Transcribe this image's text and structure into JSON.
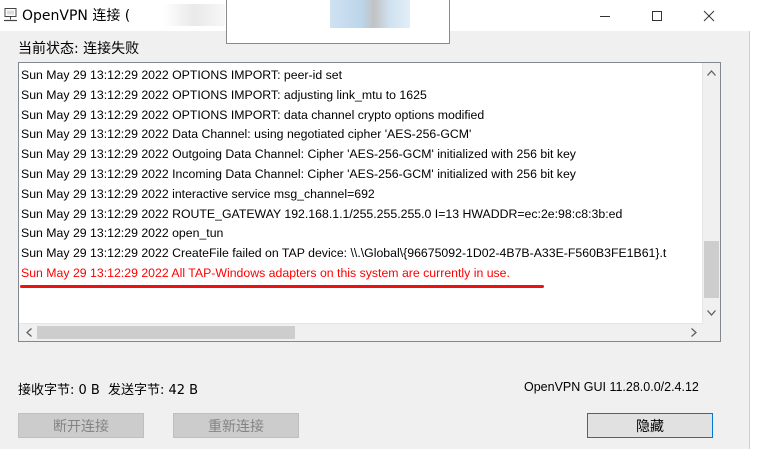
{
  "window": {
    "title": "OpenVPN 连接 (",
    "controls": {
      "minimize": "—",
      "maximize": "☐",
      "close": "✕"
    }
  },
  "status": {
    "label": "当前状态:",
    "value": "连接失败"
  },
  "log": {
    "lines": [
      {
        "text": "Sun May 29 13:12:29 2022 OPTIONS IMPORT: peer-id set",
        "error": false
      },
      {
        "text": "Sun May 29 13:12:29 2022 OPTIONS IMPORT: adjusting link_mtu to 1625",
        "error": false
      },
      {
        "text": "Sun May 29 13:12:29 2022 OPTIONS IMPORT: data channel crypto options modified",
        "error": false
      },
      {
        "text": "Sun May 29 13:12:29 2022 Data Channel: using negotiated cipher 'AES-256-GCM'",
        "error": false
      },
      {
        "text": "Sun May 29 13:12:29 2022 Outgoing Data Channel: Cipher 'AES-256-GCM' initialized with 256 bit key",
        "error": false
      },
      {
        "text": "Sun May 29 13:12:29 2022 Incoming Data Channel: Cipher 'AES-256-GCM' initialized with 256 bit key",
        "error": false
      },
      {
        "text": "Sun May 29 13:12:29 2022 interactive service msg_channel=692",
        "error": false
      },
      {
        "text": "Sun May 29 13:12:29 2022 ROUTE_GATEWAY 192.168.1.1/255.255.255.0 I=13 HWADDR=ec:2e:98:c8:3b:ed",
        "error": false
      },
      {
        "text": "Sun May 29 13:12:29 2022 open_tun",
        "error": false
      },
      {
        "text": "Sun May 29 13:12:29 2022 CreateFile failed on TAP device: \\\\.\\Global\\{96675092-1D02-4B7B-A33E-F560B3FE1B61}.t",
        "error": false
      },
      {
        "text": "Sun May 29 13:12:29 2022 All TAP-Windows adapters on this system are currently in use.",
        "error": true
      }
    ]
  },
  "stats": {
    "received": "接收字节: 0 B",
    "sent": "发送字节: 42 B"
  },
  "version": "OpenVPN GUI 11.28.0.0/2.4.12",
  "buttons": {
    "disconnect": "断开连接",
    "reconnect": "重新连接",
    "hide": "隐藏"
  },
  "colors": {
    "error_text": "#ff0000",
    "annotation_underline": "#ee1111",
    "primary_border": "#0078d7"
  }
}
